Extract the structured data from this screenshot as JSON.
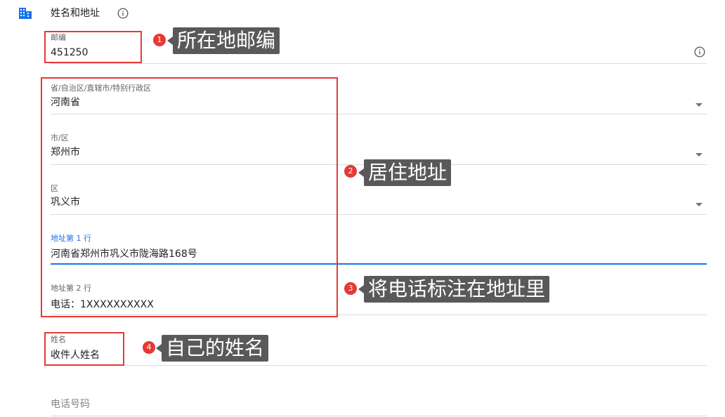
{
  "section": {
    "title": "姓名和地址"
  },
  "postal": {
    "label": "邮编",
    "value": "451250"
  },
  "province": {
    "label": "省/自治区/直辖市/特别行政区",
    "value": "河南省"
  },
  "city": {
    "label": "市/区",
    "value": "郑州市"
  },
  "district": {
    "label": "区",
    "value": "巩义市"
  },
  "address1": {
    "label": "地址第 1 行",
    "value": "河南省郑州市巩义市陇海路168号"
  },
  "address2": {
    "label": "地址第 2 行",
    "value": "电话：1XXXXXXXXXX"
  },
  "name": {
    "label": "姓名",
    "value": "收件人姓名"
  },
  "phone": {
    "placeholder": "电话号码"
  },
  "annotations": [
    {
      "number": "1",
      "text": "所在地邮编"
    },
    {
      "number": "2",
      "text": "居住地址"
    },
    {
      "number": "3",
      "text": "将电话标注在地址里"
    },
    {
      "number": "4",
      "text": "自己的姓名"
    }
  ],
  "colors": {
    "accent": "#1a73e8",
    "highlight": "#e53935",
    "callout_bg": "#595959"
  },
  "icons": {
    "section": "building-icon",
    "info": "info-icon",
    "dropdown": "dropdown-arrow-icon"
  }
}
